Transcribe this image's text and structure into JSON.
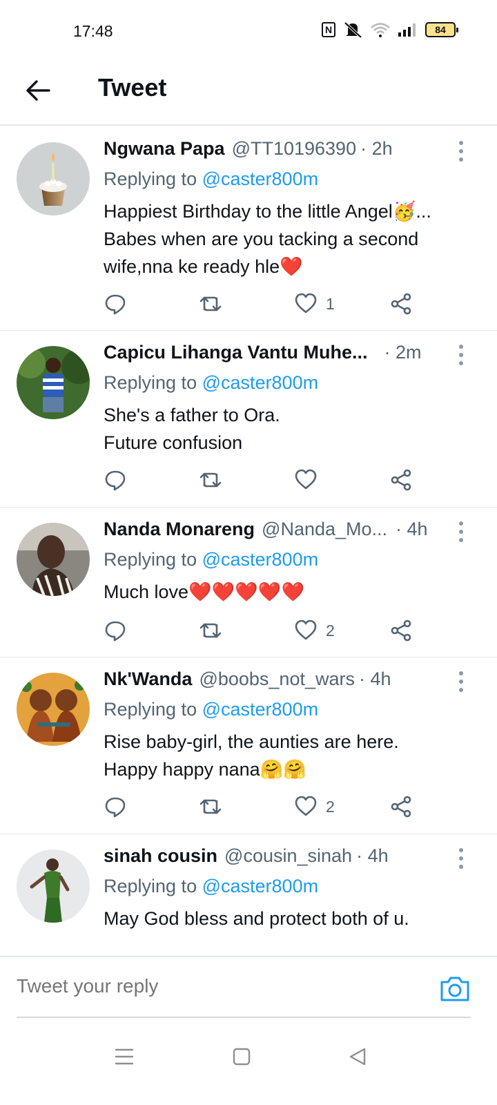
{
  "status_bar": {
    "time": "17:48",
    "battery": "84",
    "nfc_glyph": "N",
    "icons": [
      "nfc-icon",
      "mute-icon",
      "wifi-icon",
      "signal-icon",
      "battery-icon"
    ]
  },
  "header": {
    "title": "Tweet",
    "back_icon": "arrow-left-icon"
  },
  "tweets": [
    {
      "name": "Ngwana Papa",
      "handle": "@TT10196390",
      "time": "· 2h",
      "reply_prefix": "Replying to",
      "reply_to": "@caster800m",
      "text": "Happiest Birthday to the little Angel🥳...\nBabes when are you tacking a second wife,nna ke ready hle❤️",
      "replies": "",
      "retweets": "",
      "likes": "1"
    },
    {
      "name": "Capicu Lihanga Vantu Muhe...",
      "handle": "",
      "time": "· 2m",
      "reply_prefix": "Replying to",
      "reply_to": "@caster800m",
      "text": "She's a father to Ora.\nFuture confusion",
      "replies": "",
      "retweets": "",
      "likes": ""
    },
    {
      "name": "Nanda Monareng",
      "handle": "@Nanda_Mo...",
      "time": "· 4h",
      "reply_prefix": "Replying to",
      "reply_to": "@caster800m",
      "text": "Much love❤️❤️❤️❤️❤️",
      "replies": "",
      "retweets": "",
      "likes": "2"
    },
    {
      "name": "Nk'Wanda",
      "handle": "@boobs_not_wars",
      "time": "· 4h",
      "reply_prefix": "Replying to",
      "reply_to": "@caster800m",
      "text": "Rise baby-girl, the aunties are here.\nHappy happy nana🤗🤗",
      "replies": "",
      "retweets": "",
      "likes": "2"
    },
    {
      "name": "sinah cousin",
      "handle": "@cousin_sinah",
      "time": "· 4h",
      "reply_prefix": "Replying to",
      "reply_to": "@caster800m",
      "text": "May God bless and protect both of u.",
      "replies": "",
      "retweets": "",
      "likes": ""
    }
  ],
  "reply_box": {
    "placeholder": "Tweet your reply",
    "camera_icon": "camera-icon"
  },
  "nav_bar": {
    "icons": [
      "menu-icon",
      "home-square-icon",
      "back-triangle-icon"
    ]
  },
  "colors": {
    "accent": "#1d9bf0",
    "secondary_text": "#536471",
    "divider": "#e3e6e8",
    "battery_fill": "#fbe28a"
  }
}
